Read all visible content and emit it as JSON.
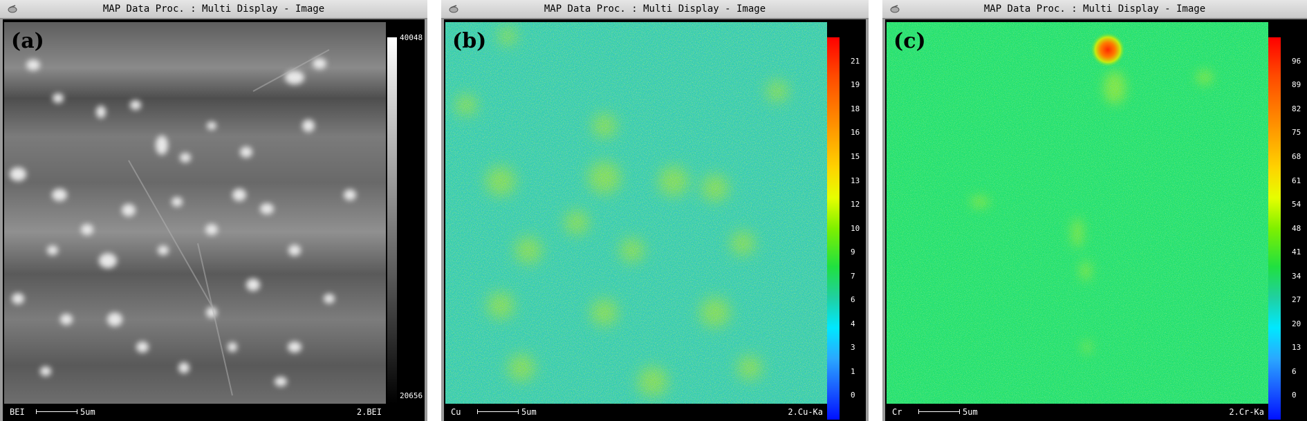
{
  "panels": [
    {
      "title": "MAP Data Proc. : Multi Display - Image",
      "label": "(a)",
      "element": "BEI",
      "scale_label": "5um",
      "channel": "2.BEI",
      "colormap": "grayscale",
      "colorbar_ticks": [
        "40048",
        "20656"
      ]
    },
    {
      "title": "MAP Data Proc. : Multi Display - Image",
      "label": "(b)",
      "element": "Cu",
      "scale_label": "5um",
      "channel": "2.Cu-Ka",
      "colormap": "rainbow",
      "colorbar_ticks": [
        "21",
        "19",
        "18",
        "16",
        "15",
        "13",
        "12",
        "10",
        "9",
        "7",
        "6",
        "4",
        "3",
        "1",
        "0"
      ]
    },
    {
      "title": "MAP Data Proc. : Multi Display - Image",
      "label": "(c)",
      "element": "Cr",
      "scale_label": "5um",
      "channel": "2.Cr-Ka",
      "colormap": "rainbow",
      "colorbar_ticks": [
        "96",
        "89",
        "82",
        "75",
        "68",
        "61",
        "54",
        "48",
        "41",
        "34",
        "27",
        "20",
        "13",
        "6",
        "0"
      ]
    }
  ],
  "colors": {
    "titlebar": "#d6d6d6",
    "frame": "#9b9b9b",
    "cu_background": "#2fd0a8",
    "cr_background": "#22e06a",
    "hotspot": "#ff2a00"
  },
  "icons": [
    "window-menu-icon"
  ]
}
